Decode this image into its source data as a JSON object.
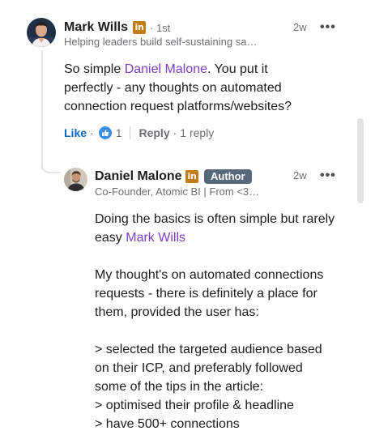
{
  "comment": {
    "author": "Mark Wills",
    "degree": "· 1st",
    "headline": "Helping leaders build self-sustaining sa…",
    "time": "2w",
    "text_before": "So simple ",
    "mention": "Daniel Malone",
    "text_after": ". You put it perfectly - any thoughts on automated connection request platforms/websites?",
    "like_label": "Like",
    "like_count": "1",
    "reply_label": "Reply",
    "reply_count": "1 reply"
  },
  "reply": {
    "author": "Daniel Malone",
    "badge": "Author",
    "headline": "Co-Founder, Atomic BI | From <3…",
    "time": "2w",
    "line1_before": "Doing the basics is often simple but rarely easy ",
    "mention": "Mark Wills",
    "para2": "My thought's on automated connections requests - there is definitely a place for them, provided the user has:",
    "para3": "> selected the targeted audience based on their ICP, and preferably followed some of the tips in the article:",
    "para4": "> optimised their profile & headline",
    "para5": "> have 500+ connections"
  },
  "icons": {
    "linkedin_badge": "in",
    "more": "•••"
  },
  "colors": {
    "mention": "#7b3fc4",
    "like": "#0a66c2",
    "linkedin_badge": "#c37d16",
    "author_badge": "#56687a"
  }
}
